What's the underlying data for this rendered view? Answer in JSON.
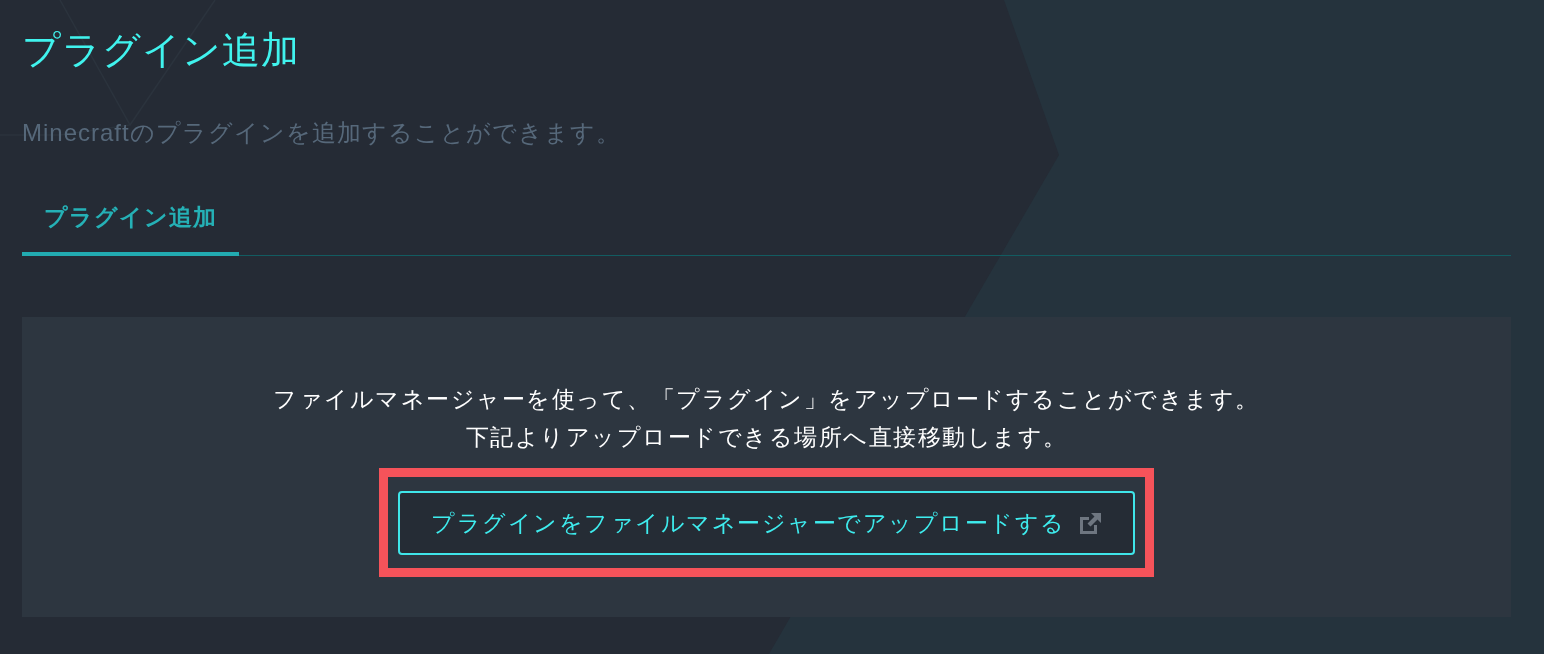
{
  "page": {
    "title": "プラグイン追加",
    "description": "Minecraftのプラグインを追加することができます。"
  },
  "tabs": [
    {
      "label": "プラグイン追加",
      "selected": true
    }
  ],
  "panel": {
    "lines": [
      "ファイルマネージャーを使って、「プラグイン」をアップロードすることができます。",
      "下記よりアップロードできる場所へ直接移動します。"
    ],
    "button": {
      "label": "プラグインをファイルマネージャーでアップロードする",
      "highlighted": true
    }
  }
}
